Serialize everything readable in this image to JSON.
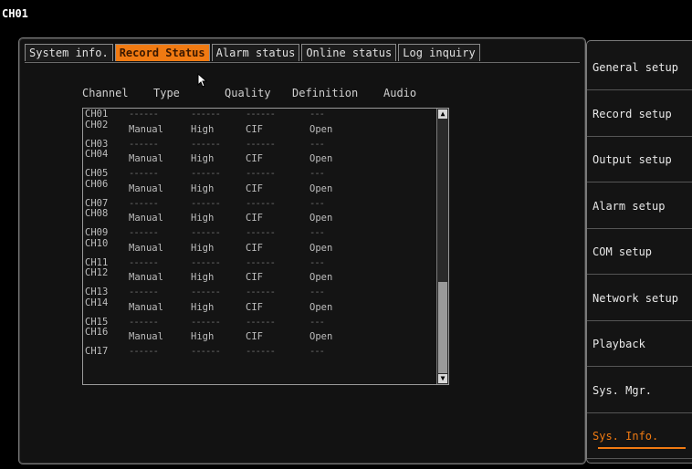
{
  "header": {
    "channel": "CH01"
  },
  "tabs": [
    {
      "label": "System info."
    },
    {
      "label": "Record Status"
    },
    {
      "label": "Alarm status"
    },
    {
      "label": "Online status"
    },
    {
      "label": "Log inquiry"
    }
  ],
  "active_tab": "Record Status",
  "columns": {
    "channel": "Channel",
    "type": "Type",
    "quality": "Quality",
    "definition": "Definition",
    "audio": "Audio"
  },
  "rows": [
    {
      "channel": "CH01",
      "type": "------",
      "quality": "------",
      "definition": "------",
      "audio": "---"
    },
    {
      "channel": "CH02",
      "type": "Manual",
      "quality": "High",
      "definition": "CIF",
      "audio": "Open"
    },
    {
      "channel": "CH03",
      "type": "------",
      "quality": "------",
      "definition": "------",
      "audio": "---"
    },
    {
      "channel": "CH04",
      "type": "Manual",
      "quality": "High",
      "definition": "CIF",
      "audio": "Open"
    },
    {
      "channel": "CH05",
      "type": "------",
      "quality": "------",
      "definition": "------",
      "audio": "---"
    },
    {
      "channel": "CH06",
      "type": "Manual",
      "quality": "High",
      "definition": "CIF",
      "audio": "Open"
    },
    {
      "channel": "CH07",
      "type": "------",
      "quality": "------",
      "definition": "------",
      "audio": "---"
    },
    {
      "channel": "CH08",
      "type": "Manual",
      "quality": "High",
      "definition": "CIF",
      "audio": "Open"
    },
    {
      "channel": "CH09",
      "type": "------",
      "quality": "------",
      "definition": "------",
      "audio": "---"
    },
    {
      "channel": "CH10",
      "type": "Manual",
      "quality": "High",
      "definition": "CIF",
      "audio": "Open"
    },
    {
      "channel": "CH11",
      "type": "------",
      "quality": "------",
      "definition": "------",
      "audio": "---"
    },
    {
      "channel": "CH12",
      "type": "Manual",
      "quality": "High",
      "definition": "CIF",
      "audio": "Open"
    },
    {
      "channel": "CH13",
      "type": "------",
      "quality": "------",
      "definition": "------",
      "audio": "---"
    },
    {
      "channel": "CH14",
      "type": "Manual",
      "quality": "High",
      "definition": "CIF",
      "audio": "Open"
    },
    {
      "channel": "CH15",
      "type": "------",
      "quality": "------",
      "definition": "------",
      "audio": "---"
    },
    {
      "channel": "CH16",
      "type": "Manual",
      "quality": "High",
      "definition": "CIF",
      "audio": "Open"
    },
    {
      "channel": "CH17",
      "type": "------",
      "quality": "------",
      "definition": "------",
      "audio": "---"
    }
  ],
  "menu": [
    {
      "label": "General setup"
    },
    {
      "label": "Record setup"
    },
    {
      "label": "Output setup"
    },
    {
      "label": "Alarm setup"
    },
    {
      "label": "COM setup"
    },
    {
      "label": "Network setup"
    },
    {
      "label": "Playback"
    },
    {
      "label": "Sys. Mgr."
    },
    {
      "label": "Sys. Info."
    }
  ],
  "active_menu": "Sys. Info.",
  "colors": {
    "accent": "#f07a12",
    "background": "#000000",
    "panel": "#121212"
  },
  "icons": {
    "cursor": "mouse-pointer-icon",
    "scroll_up": "scroll-up-arrow-icon",
    "scroll_down": "scroll-down-arrow-icon"
  }
}
